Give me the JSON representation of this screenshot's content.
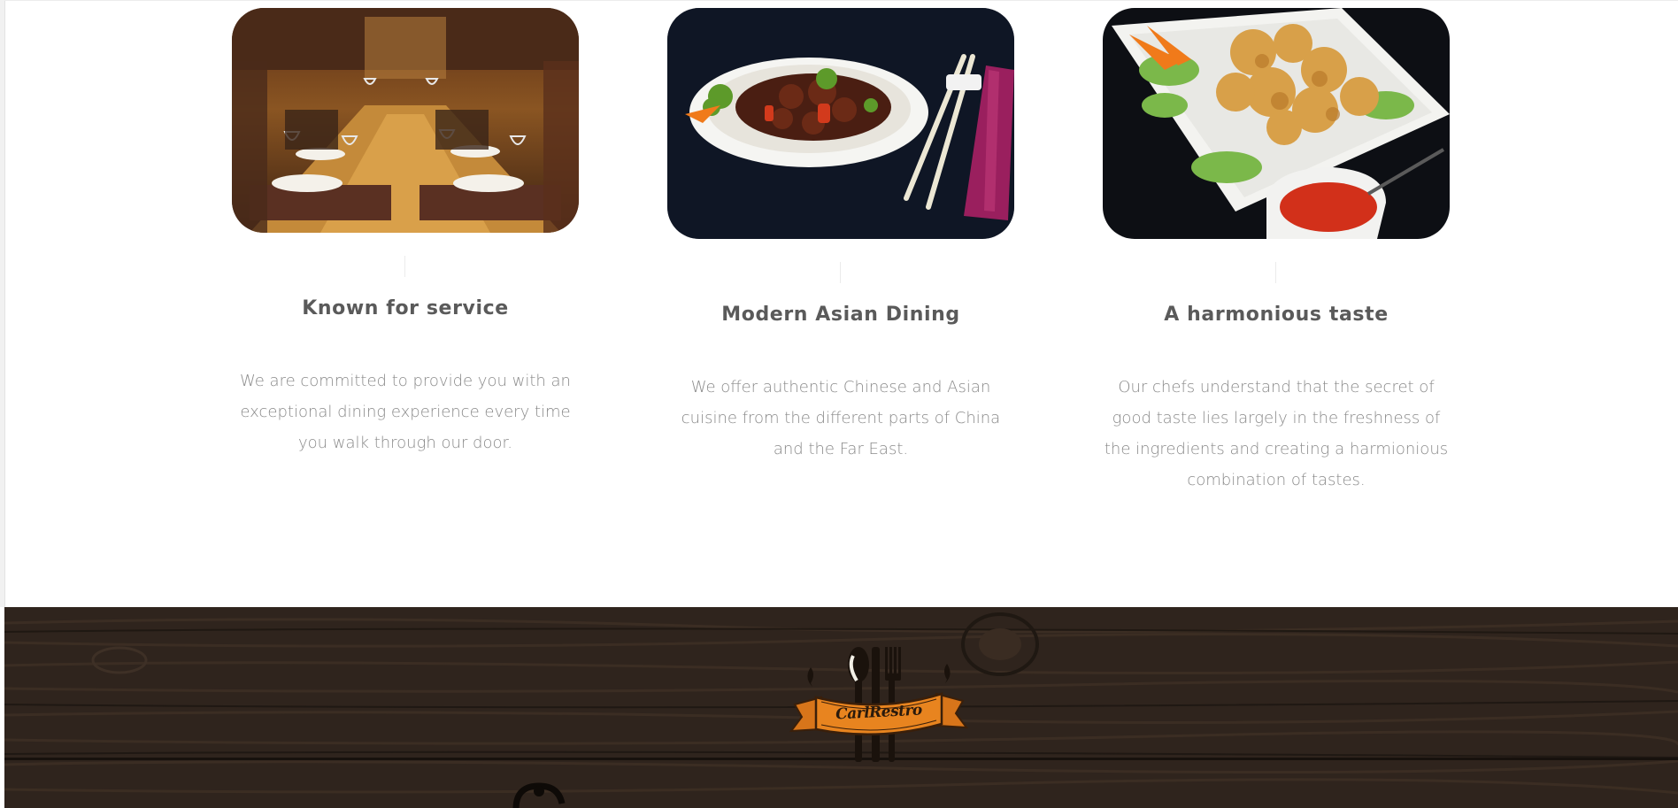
{
  "features": [
    {
      "image": "restaurant-dining-room-photo",
      "title": "Known for service",
      "description": "We are committed to provide you with an exceptional dining experience every time you walk through our door."
    },
    {
      "image": "asian-beef-dish-photo",
      "title": "Modern Asian Dining",
      "description": "We offer authentic Chinese and Asian cuisine from the different parts of China and the Far East."
    },
    {
      "image": "fried-shrimp-plate-photo",
      "title": "A harmonious taste",
      "description": "Our chefs understand that the secret of good taste lies largely in the freshness of the ingredients and creating a harmionious combination of tastes."
    }
  ],
  "footer": {
    "logo_text": "CarlRestro",
    "logo_icon": "cutlery-ribbon-icon"
  },
  "colors": {
    "heading": "#5a5a5a",
    "body_text": "#8a8a8a",
    "footer_wood": "#2f241d",
    "ribbon": "#d8751a"
  }
}
